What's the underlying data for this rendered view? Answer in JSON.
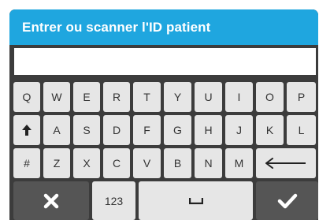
{
  "header": {
    "title": "Entrer ou scanner l'ID patient"
  },
  "patient_id_input": {
    "value": ""
  },
  "keyboard": {
    "row1": [
      "Q",
      "W",
      "E",
      "R",
      "T",
      "Y",
      "U",
      "I",
      "O",
      "P"
    ],
    "row2": [
      "A",
      "S",
      "D",
      "F",
      "G",
      "H",
      "J",
      "K",
      "L"
    ],
    "row3": [
      "Z",
      "X",
      "C",
      "V",
      "B",
      "N",
      "M"
    ],
    "shift_icon": "up-arrow-icon",
    "symbol_key": "#",
    "backspace_icon": "left-arrow-icon",
    "cancel_icon": "close-icon",
    "numeric_key": "123",
    "space_icon": "space-bar-icon",
    "confirm_icon": "checkmark-icon"
  },
  "colors": {
    "header_bg": "#1fa6df",
    "panel_bg": "#3c3c3c",
    "key_bg": "#e6e6e6",
    "dark_key_bg": "#555555"
  }
}
